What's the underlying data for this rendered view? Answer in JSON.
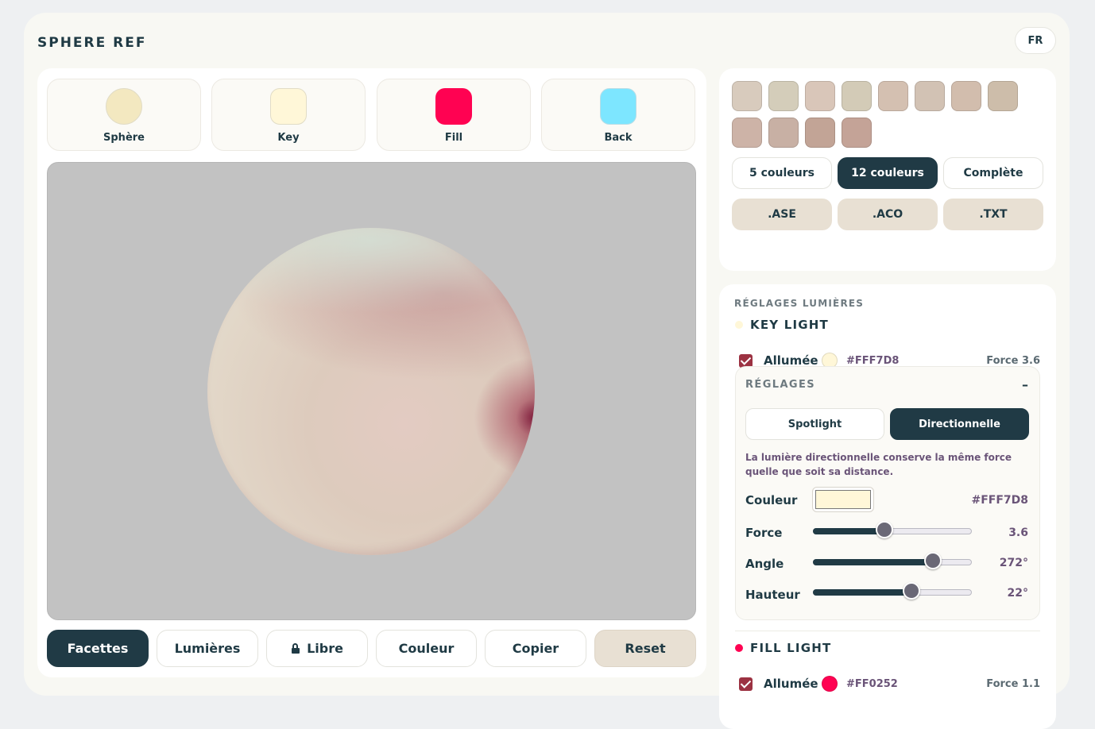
{
  "app": {
    "title": "SPHERE REF",
    "lang": "FR"
  },
  "swatches": [
    {
      "label": "Sphère",
      "color": "#f3e8c0"
    },
    {
      "label": "Key",
      "color": "#fff7d8"
    },
    {
      "label": "Fill",
      "color": "#ff0252"
    },
    {
      "label": "Back",
      "color": "#7de6ff"
    }
  ],
  "viewport": {
    "background": "#c2c2c2"
  },
  "toolbar": {
    "facets": "Facettes",
    "lights": "Lumières",
    "free": "Libre",
    "color": "Couleur",
    "copy": "Copier",
    "reset": "Reset"
  },
  "palette": {
    "chips": [
      "#d8cbbd",
      "#d4cdba",
      "#d9c6b9",
      "#d3cbb7",
      "#d4c0b1",
      "#d2c2b4",
      "#d2bdad",
      "#cdbdaa",
      "#cdb3a7",
      "#c8b0a4",
      "#c2a496",
      "#c4a397"
    ],
    "counts": [
      "5 couleurs",
      "12 couleurs",
      "Complète"
    ],
    "active_count": "12 couleurs",
    "exports": [
      ".ASE",
      ".ACO",
      ".TXT"
    ]
  },
  "lights": {
    "section_title": "RÉGLAGES LUMIÈRES",
    "key": {
      "name": "KEY LIGHT",
      "on_label": "Allumée",
      "color": "#fff7d8",
      "hex": "#FFF7D8",
      "force_label": "Force 3.6",
      "settings": {
        "title": "RÉGLAGES",
        "collapse": "–",
        "modes": [
          "Spotlight",
          "Directionnelle"
        ],
        "active_mode": "Directionnelle",
        "description": "La lumière directionnelle conserve la même force quelle que soit sa distance.",
        "color_label": "Couleur",
        "color_hex": "#FFF7D8",
        "force": {
          "label": "Force",
          "value": 3.6,
          "display": "3.6",
          "min": 0,
          "max": 8
        },
        "angle": {
          "label": "Angle",
          "value": 272,
          "display": "272°",
          "min": 0,
          "max": 360
        },
        "height": {
          "label": "Hauteur",
          "value": 22,
          "display": "22°",
          "min": -90,
          "max": 90
        }
      }
    },
    "fill": {
      "name": "FILL LIGHT",
      "on_label": "Allumée",
      "color": "#ff0252",
      "hex": "#FF0252",
      "force_label": "Force 1.1"
    }
  }
}
